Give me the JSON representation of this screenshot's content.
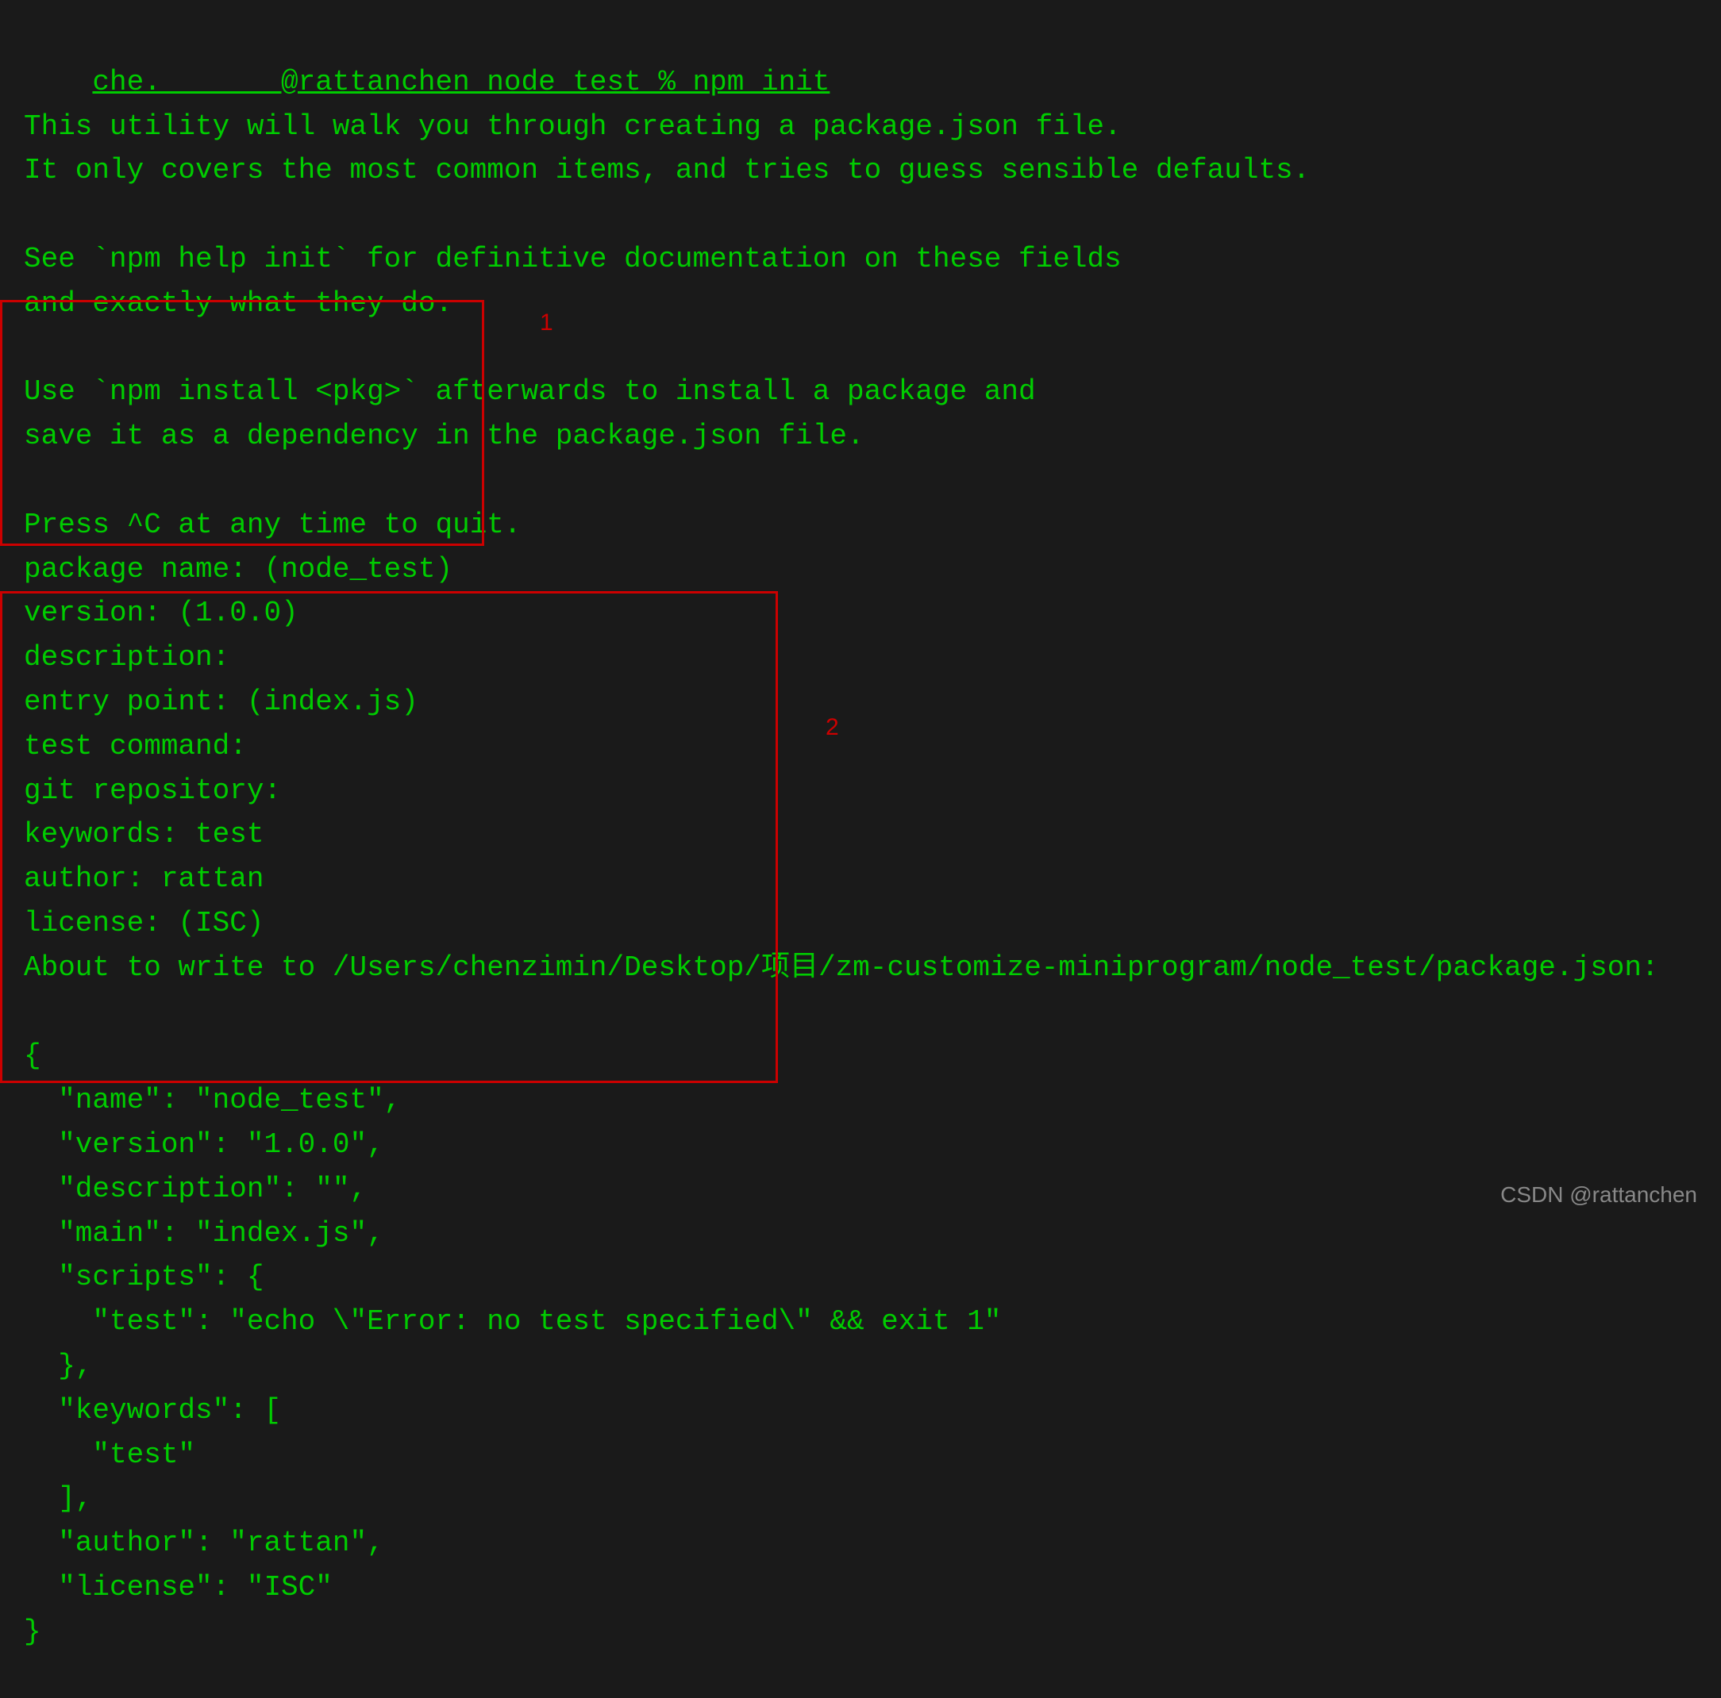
{
  "terminal": {
    "prompt": "che.       @rattanchen node_test % npm init",
    "lines": [
      "This utility will walk you through creating a package.json file.",
      "It only covers the most common items, and tries to guess sensible defaults.",
      "",
      "See `npm help init` for definitive documentation on these fields",
      "and exactly what they do.",
      "",
      "Use `npm install <pkg>` afterwards to install a package and",
      "save it as a dependency in the package.json file.",
      "",
      "Press ^C at any time to quit.",
      "package name: (node_test)",
      "version: (1.0.0)",
      "description:",
      "entry point: (index.js)",
      "test command:",
      "git repository:",
      "keywords: test",
      "author: rattan",
      "license: (ISC)",
      "About to write to /Users/chenzimin/Desktop/项目/zm-customize-miniprogram/node_test/package.json:",
      "",
      "{",
      "  \"name\": \"node_test\",",
      "  \"version\": \"1.0.0\",",
      "  \"description\": \"\",",
      "  \"main\": \"index.js\",",
      "  \"scripts\": {",
      "    \"test\": \"echo \\\"Error: no test specified\\\" && exit 1\"",
      "  },",
      "  \"keywords\": [",
      "    \"test\"",
      "  ],",
      "  \"author\": \"rattan\",",
      "  \"license\": \"ISC\"",
      "}"
    ],
    "annotation1": "1",
    "annotation2": "2",
    "watermark": "CSDN @rattanchen"
  }
}
